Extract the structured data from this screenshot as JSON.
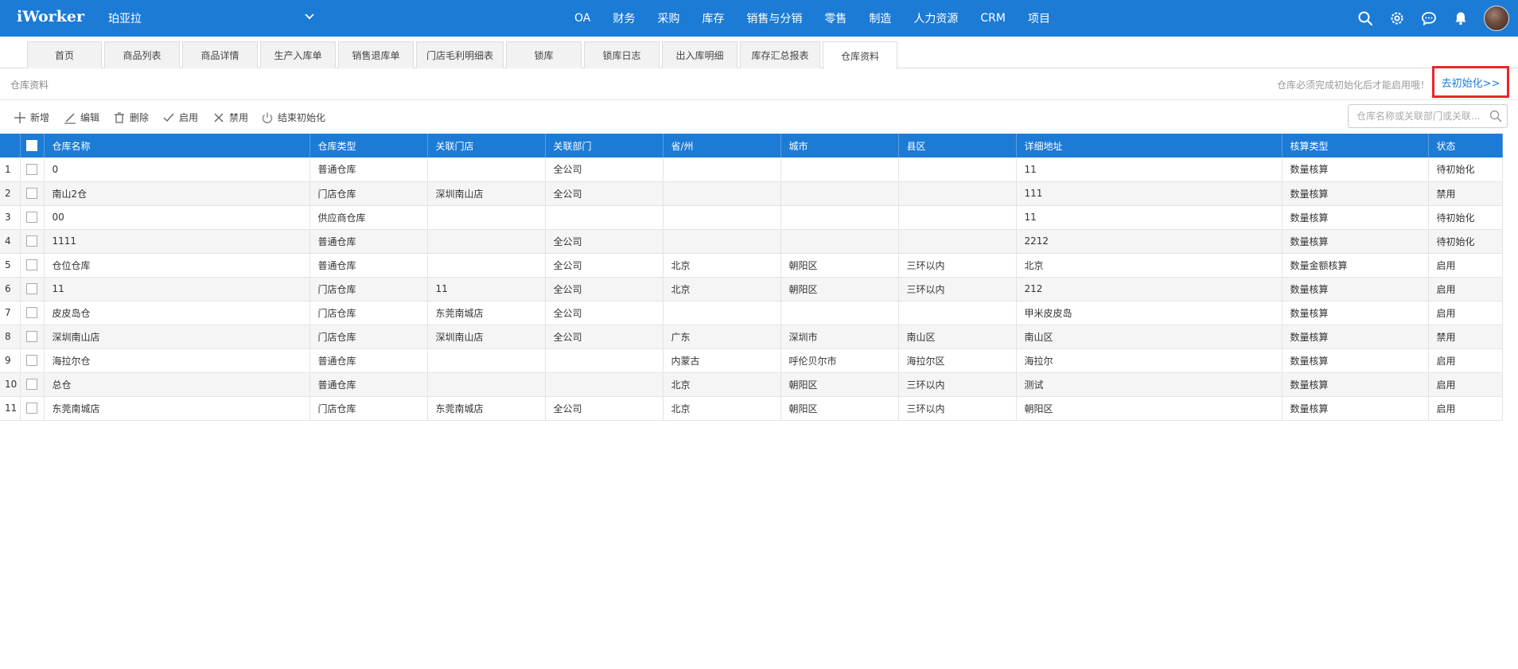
{
  "topbar": {
    "logo": "iWorker",
    "company": "珀亚拉",
    "nav": [
      "OA",
      "财务",
      "采购",
      "库存",
      "销售与分销",
      "零售",
      "制造",
      "人力资源",
      "CRM",
      "项目"
    ]
  },
  "tabs": [
    "首页",
    "商品列表",
    "商品详情",
    "生产入库单",
    "销售退库单",
    "门店毛利明细表",
    "锁库",
    "锁库日志",
    "出入库明细",
    "库存汇总报表",
    "仓库资料"
  ],
  "active_tab": "仓库资料",
  "breadcrumb": "仓库资料",
  "init_note": "仓库必须完成初始化后才能启用哦！",
  "init_link": "去初始化>>",
  "toolbar": {
    "add": "新增",
    "edit": "编辑",
    "delete": "删除",
    "enable": "启用",
    "disable": "禁用",
    "finish_init": "结束初始化"
  },
  "search": {
    "placeholder": "仓库名称或关联部门或关联..."
  },
  "table": {
    "headers": [
      "仓库名称",
      "仓库类型",
      "关联门店",
      "关联部门",
      "省/州",
      "城市",
      "县区",
      "详细地址",
      "核算类型",
      "状态"
    ],
    "rows": [
      [
        "1",
        "0",
        "普通仓库",
        "",
        "全公司",
        "",
        "",
        "",
        "11",
        "数量核算",
        "待初始化"
      ],
      [
        "2",
        "南山2仓",
        "门店仓库",
        "深圳南山店",
        "全公司",
        "",
        "",
        "",
        "111",
        "数量核算",
        "禁用"
      ],
      [
        "3",
        "00",
        "供应商仓库",
        "",
        "",
        "",
        "",
        "",
        "11",
        "数量核算",
        "待初始化"
      ],
      [
        "4",
        "1111",
        "普通仓库",
        "",
        "全公司",
        "",
        "",
        "",
        "2212",
        "数量核算",
        "待初始化"
      ],
      [
        "5",
        "仓位仓库",
        "普通仓库",
        "",
        "全公司",
        "北京",
        "朝阳区",
        "三环以内",
        "北京",
        "数量金额核算",
        "启用"
      ],
      [
        "6",
        "11",
        "门店仓库",
        "11",
        "全公司",
        "北京",
        "朝阳区",
        "三环以内",
        "212",
        "数量核算",
        "启用"
      ],
      [
        "7",
        "皮皮岛仓",
        "门店仓库",
        "东莞南城店",
        "全公司",
        "",
        "",
        "",
        "甲米皮皮岛",
        "数量核算",
        "启用"
      ],
      [
        "8",
        "深圳南山店",
        "门店仓库",
        "深圳南山店",
        "全公司",
        "广东",
        "深圳市",
        "南山区",
        "南山区",
        "数量核算",
        "禁用"
      ],
      [
        "9",
        "海拉尔仓",
        "普通仓库",
        "",
        "",
        "内蒙古",
        "呼伦贝尔市",
        "海拉尔区",
        "海拉尔",
        "数量核算",
        "启用"
      ],
      [
        "10",
        "总仓",
        "普通仓库",
        "",
        "",
        "北京",
        "朝阳区",
        "三环以内",
        "测试",
        "数量核算",
        "启用"
      ],
      [
        "11",
        "东莞南城店",
        "门店仓库",
        "东莞南城店",
        "全公司",
        "北京",
        "朝阳区",
        "三环以内",
        "朝阳区",
        "数量核算",
        "启用"
      ]
    ]
  },
  "colors": {
    "primary": "#1c7bd5",
    "highlight_border": "#e8272a"
  }
}
